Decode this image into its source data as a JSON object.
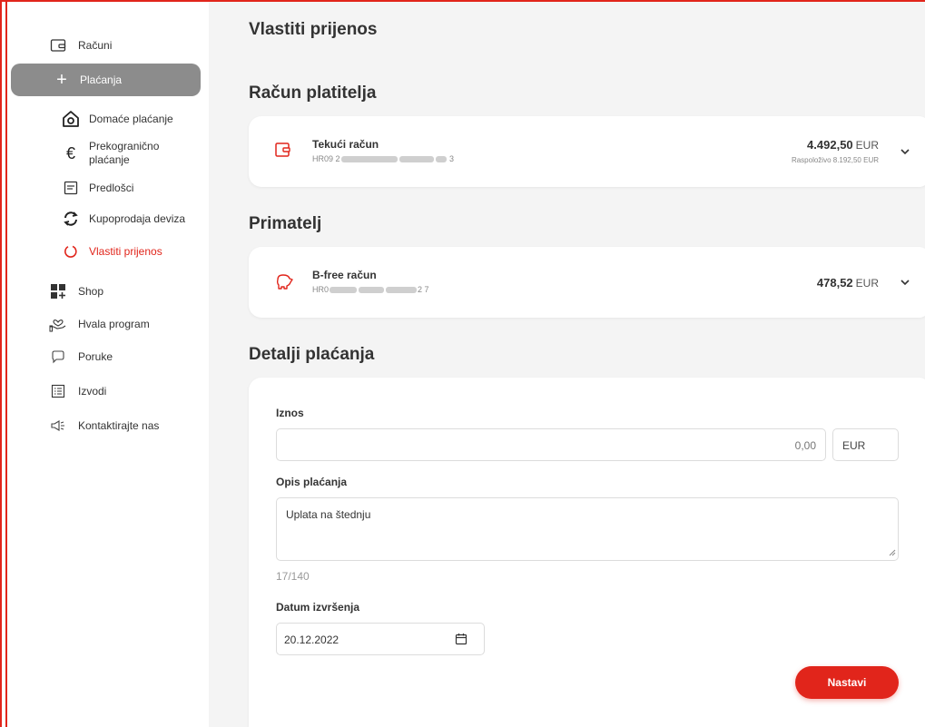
{
  "sidebar": {
    "items": [
      {
        "label": "Računi",
        "icon": "wallet-icon"
      },
      {
        "label": "Plaćanja",
        "icon": "plus-icon"
      },
      {
        "label": "Domaće plaćanje",
        "icon": "home-icon"
      },
      {
        "label": "Prekogranično plaćanje",
        "icon": "euro-icon"
      },
      {
        "label": "Predlošci",
        "icon": "template-icon"
      },
      {
        "label": "Kupoprodaja deviza",
        "icon": "exchange-icon"
      },
      {
        "label": "Vlastiti prijenos",
        "icon": "transfer-icon"
      },
      {
        "label": "Shop",
        "icon": "grid-icon"
      },
      {
        "label": "Hvala program",
        "icon": "heart-hand-icon"
      },
      {
        "label": "Poruke",
        "icon": "chat-icon"
      },
      {
        "label": "Izvodi",
        "icon": "statement-icon"
      },
      {
        "label": "Kontaktirajte nas",
        "icon": "megaphone-icon"
      }
    ],
    "prekogranicno_line1": "Prekogranično",
    "prekogranicno_line2": "plaćanje"
  },
  "page": {
    "title": "Vlastiti prijenos",
    "payer_heading": "Račun platitelja",
    "recipient_heading": "Primatelj",
    "details_heading": "Detalji plaćanja"
  },
  "payer": {
    "name": "Tekući račun",
    "iban_start": "HR09 2",
    "iban_end": "3",
    "amount": "4.492,50",
    "currency": "EUR",
    "available": "Raspoloživo 8.192,50  EUR"
  },
  "recipient": {
    "name": "B-free račun",
    "iban_start": "HR0",
    "iban_end": "2 7",
    "amount": "478,52",
    "currency": "EUR"
  },
  "form": {
    "amount_label": "Iznos",
    "amount_placeholder": "0,00",
    "currency": "EUR",
    "description_label": "Opis plaćanja",
    "description_value": "Uplata na štednju",
    "counter": "17/140",
    "date_label": "Datum izvršenja",
    "date_value": "20.12.2022",
    "submit_label": "Nastavi"
  },
  "colors": {
    "accent": "#e1251b",
    "active_nav": "#8c8c8c",
    "background": "#f4f4f4"
  }
}
